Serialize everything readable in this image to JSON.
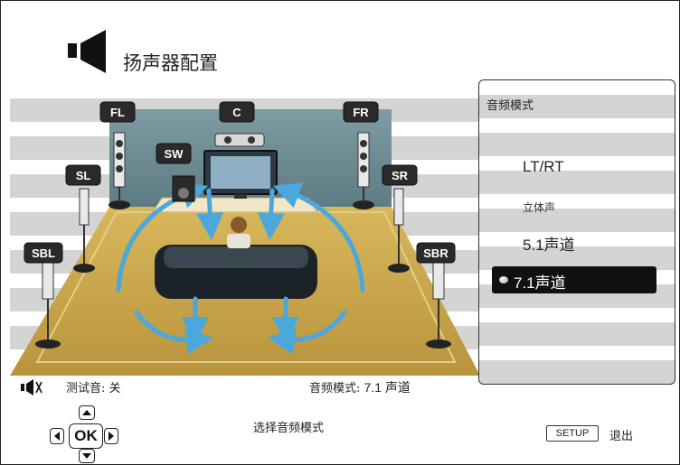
{
  "header": {
    "title": "扬声器配置",
    "icon": "speaker-icon"
  },
  "scene": {
    "speakers": [
      {
        "id": "fl",
        "label": "FL"
      },
      {
        "id": "c",
        "label": "C"
      },
      {
        "id": "fr",
        "label": "FR"
      },
      {
        "id": "sw",
        "label": "SW"
      },
      {
        "id": "sl",
        "label": "SL"
      },
      {
        "id": "sr",
        "label": "SR"
      },
      {
        "id": "sbl",
        "label": "SBL"
      },
      {
        "id": "sbr",
        "label": "SBR"
      }
    ]
  },
  "panel": {
    "title": "音频模式",
    "options": [
      "LT/RT",
      "立体声",
      "5.1声道",
      "7.1声道"
    ],
    "selected": "7.1声道"
  },
  "status": {
    "test_tone_label": "测试音: 关",
    "audio_mode_label": "音频模式:",
    "audio_mode_value": "7.1 声道"
  },
  "footer": {
    "ok_label": "OK",
    "hint": "选择音频模式",
    "setup_label": "SETUP",
    "exit_label": "退出"
  },
  "colors": {
    "floor": "#c9a64a",
    "wall": "#6f8e97",
    "arrow": "#4aa8dc",
    "selected_bg": "#111111"
  }
}
